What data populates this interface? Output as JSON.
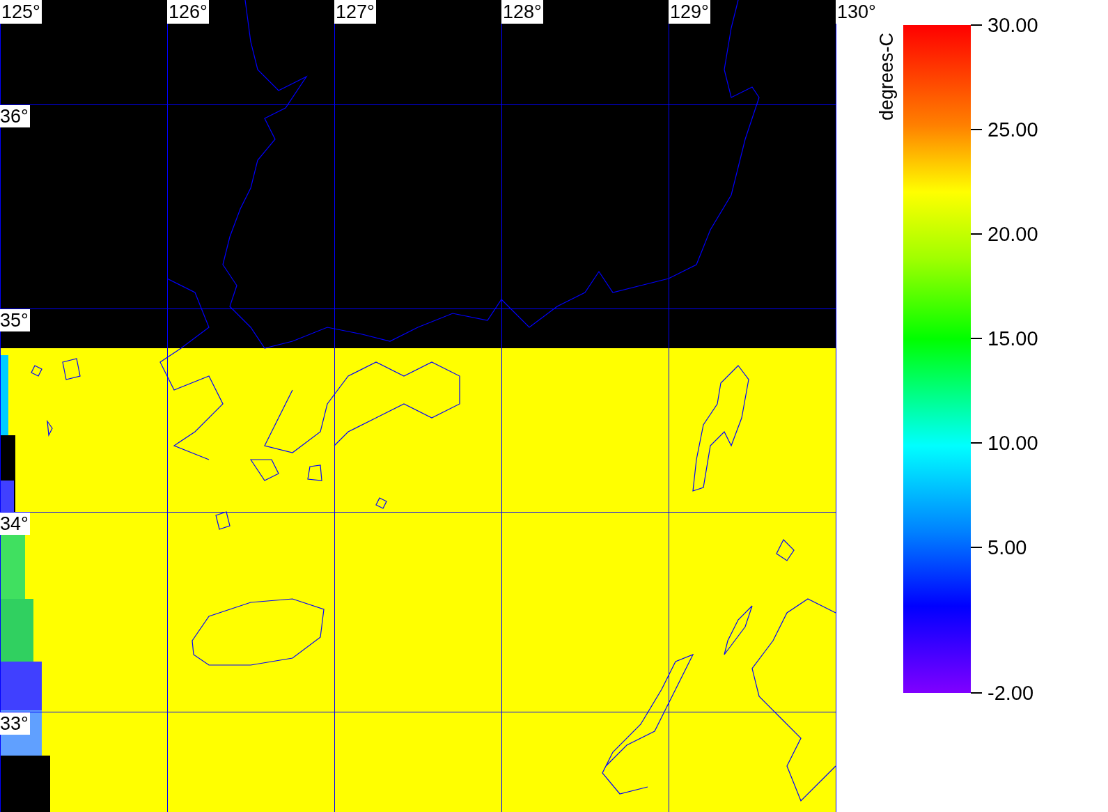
{
  "map": {
    "lon_labels": [
      "125°",
      "126°",
      "127°",
      "128°",
      "129°",
      "130°"
    ],
    "lat_labels": [
      "36°",
      "35°",
      "34°",
      "33°"
    ]
  },
  "colorbar": {
    "title": "degrees-C",
    "tick_labels": [
      "30.00",
      "25.00",
      "20.00",
      "15.00",
      "10.00",
      "5.00",
      "-2.00"
    ]
  }
}
